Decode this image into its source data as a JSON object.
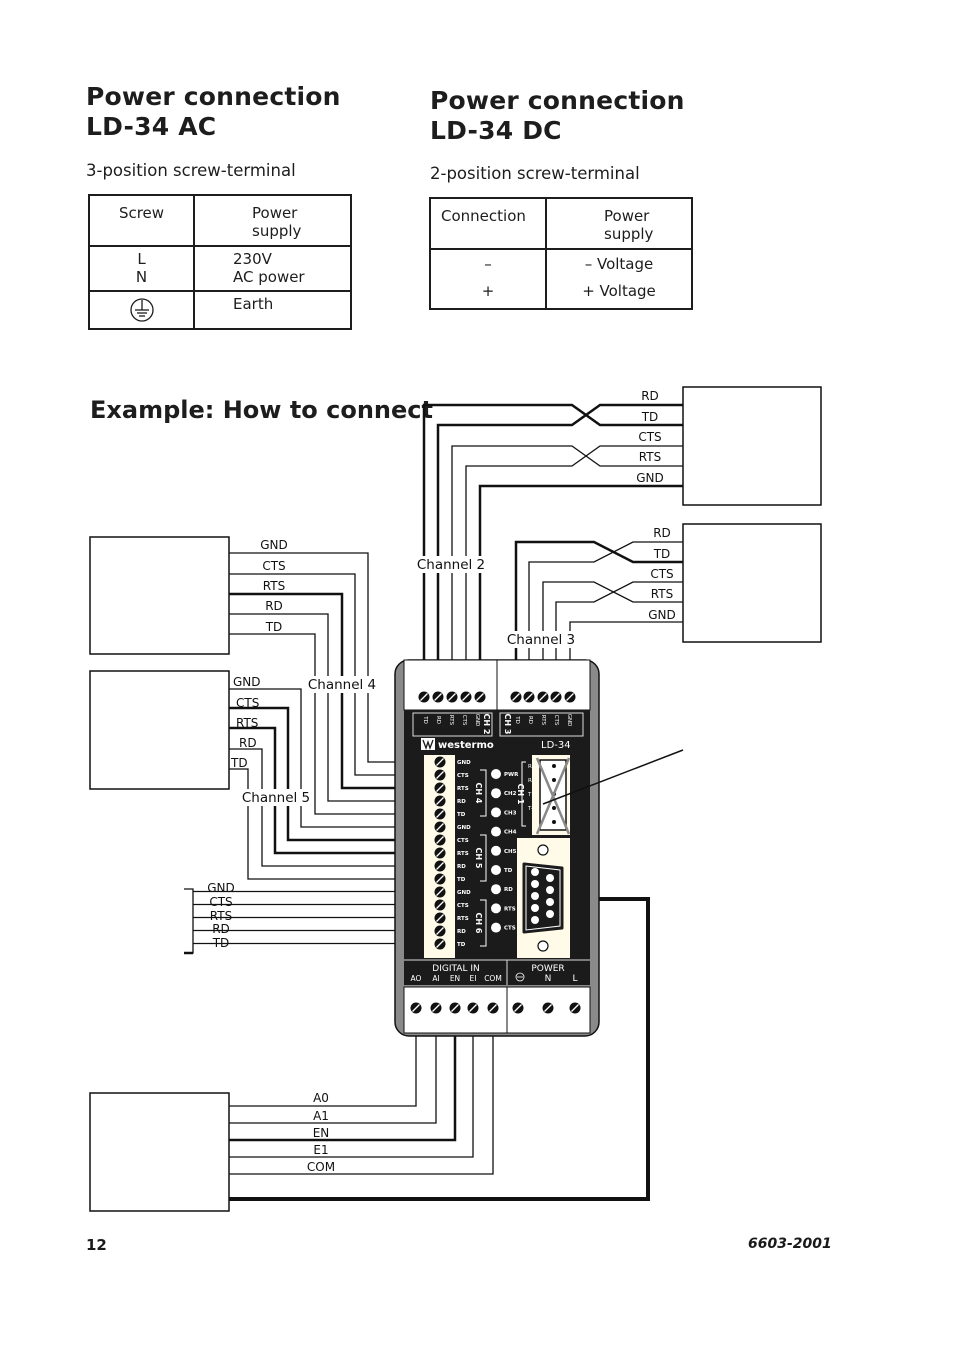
{
  "ac_section": {
    "title_line1": "Power connection",
    "title_line2": "LD-34 AC",
    "subtitle": "3-position screw-terminal",
    "table": {
      "headers": [
        "Screw",
        "Power supply"
      ],
      "header_power_line1": "Power",
      "header_power_line2": "supply",
      "rows": [
        {
          "screw_line1": "L",
          "screw_line2": "N",
          "supply_line1": "230V",
          "supply_line2": "AC power"
        },
        {
          "screw_icon": "earth-ground-icon",
          "supply_line1": "Earth"
        }
      ]
    }
  },
  "dc_section": {
    "title_line1": "Power connection",
    "title_line2": "LD-34 DC",
    "subtitle": "2-position screw-terminal",
    "table": {
      "headers": [
        "Connection",
        "Power supply"
      ],
      "header_power_line1": "Power",
      "header_power_line2": "supply",
      "rows": [
        {
          "connection": "–",
          "supply": "– Voltage"
        },
        {
          "connection": "+",
          "supply": "+ Voltage"
        }
      ]
    }
  },
  "example": {
    "title": "Example: How to connect",
    "channel_labels": {
      "ch2": "Channel 2",
      "ch3": "Channel 3",
      "ch4": "Channel 4",
      "ch5": "Channel 5"
    },
    "device_top_right_signals": [
      "RD",
      "TD",
      "CTS",
      "RTS",
      "GND"
    ],
    "device_mid_right_signals": [
      "RD",
      "TD",
      "CTS",
      "RTS",
      "GND"
    ],
    "device_ch4_signals": [
      "GND",
      "CTS",
      "RTS",
      "RD",
      "TD"
    ],
    "device_ch5_signals": [
      "GND",
      "CTS",
      "RTS",
      "RD",
      "TD"
    ],
    "ch6_signals": [
      "GND",
      "CTS",
      "RTS",
      "RD",
      "TD"
    ],
    "digital_signals": [
      "A0",
      "A1",
      "EN",
      "E1",
      "COM"
    ]
  },
  "ld34": {
    "brand": "westermo",
    "model": "LD-34",
    "ch2_label": "CH 2",
    "ch3_label": "CH 3",
    "top_pins_ch2": [
      "TD",
      "RD",
      "RTS",
      "CTS",
      "GND"
    ],
    "top_pins_ch3": [
      "TD",
      "RD",
      "RTS",
      "CTS",
      "GND"
    ],
    "left_pins": [
      "GND",
      "CTS",
      "RTS",
      "RD",
      "TD",
      "GND",
      "CTS",
      "RTS",
      "RD",
      "TD",
      "GND",
      "CTS",
      "RTS",
      "RD",
      "TD"
    ],
    "group_labels": [
      "CH 4",
      "CH 5",
      "CH 6"
    ],
    "leds": [
      "PWR",
      "CH2",
      "CH3",
      "CH4",
      "CH5",
      "TD",
      "RD",
      "RTS",
      "CTS"
    ],
    "ch1_label": "CH 1",
    "ch1_pins": [
      "R+",
      "R-",
      "T+",
      "T-"
    ],
    "digital_in_label": "DIGITAL IN",
    "digital_in_pins": [
      "AO",
      "AI",
      "EN",
      "EI",
      "COM"
    ],
    "power_label": "POWER",
    "power_pins": [
      "N",
      "L"
    ]
  },
  "footer": {
    "page_number": "12",
    "doc_number": "6603-2001"
  }
}
